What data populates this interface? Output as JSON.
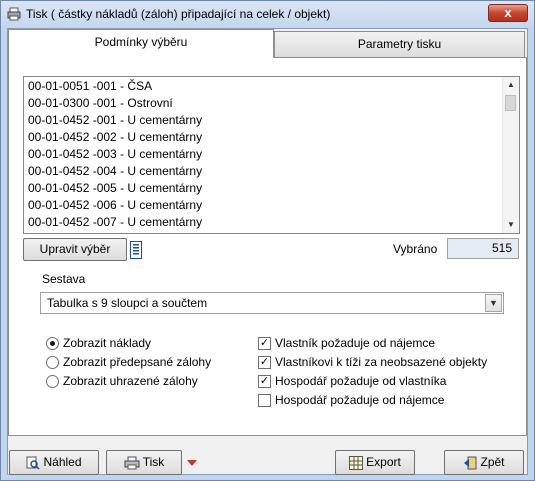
{
  "window": {
    "title": "Tisk ( částky nákladů (záloh) připadající na celek / objekt)",
    "close_label": "x"
  },
  "tabs": [
    {
      "label": "Podmínky výběru",
      "active": true
    },
    {
      "label": "Parametry tisku",
      "active": false
    }
  ],
  "list": {
    "items": [
      "00-01-0051 -001 - ČSA",
      "00-01-0300 -001 - Ostrovní",
      "00-01-0452 -001 - U cementárny",
      "00-01-0452 -002 - U cementárny",
      "00-01-0452 -003 - U cementárny",
      "00-01-0452 -004 - U cementárny",
      "00-01-0452 -005 - U cementárny",
      "00-01-0452 -006 - U cementárny",
      "00-01-0452 -007 - U cementárny"
    ]
  },
  "selection": {
    "edit_button": "Upravit výběr",
    "selected_label": "Vybráno",
    "selected_count": "515"
  },
  "report": {
    "label": "Sestava",
    "value": "Tabulka s 9 sloupci a součtem"
  },
  "display_options": [
    {
      "label": "Zobrazit náklady",
      "selected": true
    },
    {
      "label": "Zobrazit  předepsané zálohy",
      "selected": false
    },
    {
      "label": "Zobrazit uhrazené zálohy",
      "selected": false
    }
  ],
  "checks": [
    {
      "label": "Vlastník požaduje od nájemce",
      "checked": true
    },
    {
      "label": "Vlastníkovi k tíži za neobsazené objekty",
      "checked": true
    },
    {
      "label": "Hospodář požaduje od vlastníka",
      "checked": true
    },
    {
      "label": "Hospodář požaduje od nájemce",
      "checked": false
    }
  ],
  "buttons": {
    "preview": "Náhled",
    "print": "Tisk",
    "export": "Export",
    "back": "Zpět"
  },
  "colors": {
    "accent_red": "#c0392b",
    "icon_blue": "#1f4e9c"
  }
}
